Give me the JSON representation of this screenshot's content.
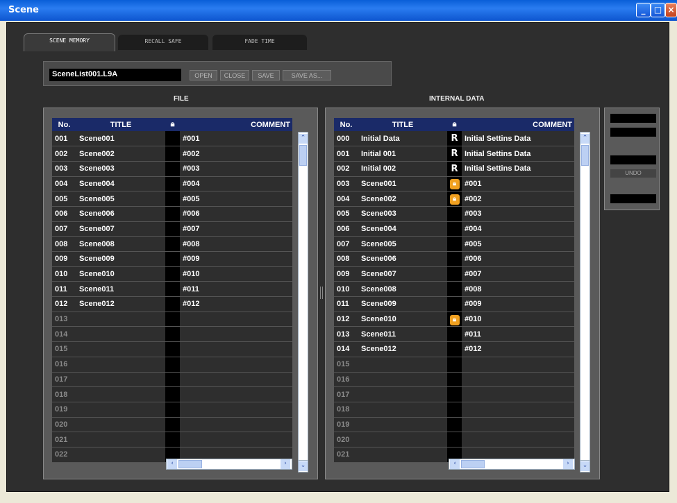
{
  "window": {
    "title": "Scene"
  },
  "tabs": [
    {
      "label": "SCENE MEMORY"
    },
    {
      "label": "RECALL SAFE"
    },
    {
      "label": "FADE TIME"
    }
  ],
  "file_bar": {
    "filename": "SceneList001.L9A",
    "buttons": [
      "OPEN",
      "CLOSE",
      "SAVE",
      "SAVE AS..."
    ]
  },
  "sections": {
    "file": "FILE",
    "internal": "INTERNAL DATA"
  },
  "columns": {
    "no": "No.",
    "title": "TITLE",
    "comment": "COMMENT"
  },
  "side": {
    "undo": "UNDO"
  },
  "file_rows": [
    {
      "no": "001",
      "title": "Scene001",
      "lock": "",
      "comment": "#001"
    },
    {
      "no": "002",
      "title": "Scene002",
      "lock": "",
      "comment": "#002"
    },
    {
      "no": "003",
      "title": "Scene003",
      "lock": "",
      "comment": "#003"
    },
    {
      "no": "004",
      "title": "Scene004",
      "lock": "",
      "comment": "#004"
    },
    {
      "no": "005",
      "title": "Scene005",
      "lock": "",
      "comment": "#005"
    },
    {
      "no": "006",
      "title": "Scene006",
      "lock": "",
      "comment": "#006"
    },
    {
      "no": "007",
      "title": "Scene007",
      "lock": "",
      "comment": "#007"
    },
    {
      "no": "008",
      "title": "Scene008",
      "lock": "",
      "comment": "#008"
    },
    {
      "no": "009",
      "title": "Scene009",
      "lock": "",
      "comment": "#009"
    },
    {
      "no": "010",
      "title": "Scene010",
      "lock": "",
      "comment": "#010"
    },
    {
      "no": "011",
      "title": "Scene011",
      "lock": "",
      "comment": "#011"
    },
    {
      "no": "012",
      "title": "Scene012",
      "lock": "",
      "comment": "#012"
    },
    {
      "no": "013",
      "title": "",
      "lock": "",
      "comment": ""
    },
    {
      "no": "014",
      "title": "",
      "lock": "",
      "comment": ""
    },
    {
      "no": "015",
      "title": "",
      "lock": "",
      "comment": ""
    },
    {
      "no": "016",
      "title": "",
      "lock": "",
      "comment": ""
    },
    {
      "no": "017",
      "title": "",
      "lock": "",
      "comment": ""
    },
    {
      "no": "018",
      "title": "",
      "lock": "",
      "comment": ""
    },
    {
      "no": "019",
      "title": "",
      "lock": "",
      "comment": ""
    },
    {
      "no": "020",
      "title": "",
      "lock": "",
      "comment": ""
    },
    {
      "no": "021",
      "title": "",
      "lock": "",
      "comment": ""
    },
    {
      "no": "022",
      "title": "",
      "lock": "",
      "comment": ""
    }
  ],
  "internal_rows": [
    {
      "no": "000",
      "title": "Initial Data",
      "lock": "R",
      "comment": "Initial Settins Data"
    },
    {
      "no": "001",
      "title": "Initial 001",
      "lock": "R",
      "comment": "Initial Settins Data"
    },
    {
      "no": "002",
      "title": "Initial 002",
      "lock": "R",
      "comment": "Initial Settins Data"
    },
    {
      "no": "003",
      "title": "Scene001",
      "lock": "lock",
      "comment": "#001"
    },
    {
      "no": "004",
      "title": "Scene002",
      "lock": "lock",
      "comment": "#002"
    },
    {
      "no": "005",
      "title": "Scene003",
      "lock": "",
      "comment": "#003"
    },
    {
      "no": "006",
      "title": "Scene004",
      "lock": "",
      "comment": "#004"
    },
    {
      "no": "007",
      "title": "Scene005",
      "lock": "",
      "comment": "#005"
    },
    {
      "no": "008",
      "title": "Scene006",
      "lock": "",
      "comment": "#006"
    },
    {
      "no": "009",
      "title": "Scene007",
      "lock": "",
      "comment": "#007"
    },
    {
      "no": "010",
      "title": "Scene008",
      "lock": "",
      "comment": "#008"
    },
    {
      "no": "011",
      "title": "Scene009",
      "lock": "",
      "comment": "#009"
    },
    {
      "no": "012",
      "title": "Scene010",
      "lock": "lock",
      "comment": "#010"
    },
    {
      "no": "013",
      "title": "Scene011",
      "lock": "",
      "comment": "#011"
    },
    {
      "no": "014",
      "title": "Scene012",
      "lock": "",
      "comment": "#012"
    },
    {
      "no": "015",
      "title": "",
      "lock": "",
      "comment": ""
    },
    {
      "no": "016",
      "title": "",
      "lock": "",
      "comment": ""
    },
    {
      "no": "017",
      "title": "",
      "lock": "",
      "comment": ""
    },
    {
      "no": "018",
      "title": "",
      "lock": "",
      "comment": ""
    },
    {
      "no": "019",
      "title": "",
      "lock": "",
      "comment": ""
    },
    {
      "no": "020",
      "title": "",
      "lock": "",
      "comment": ""
    },
    {
      "no": "021",
      "title": "",
      "lock": "",
      "comment": ""
    }
  ]
}
